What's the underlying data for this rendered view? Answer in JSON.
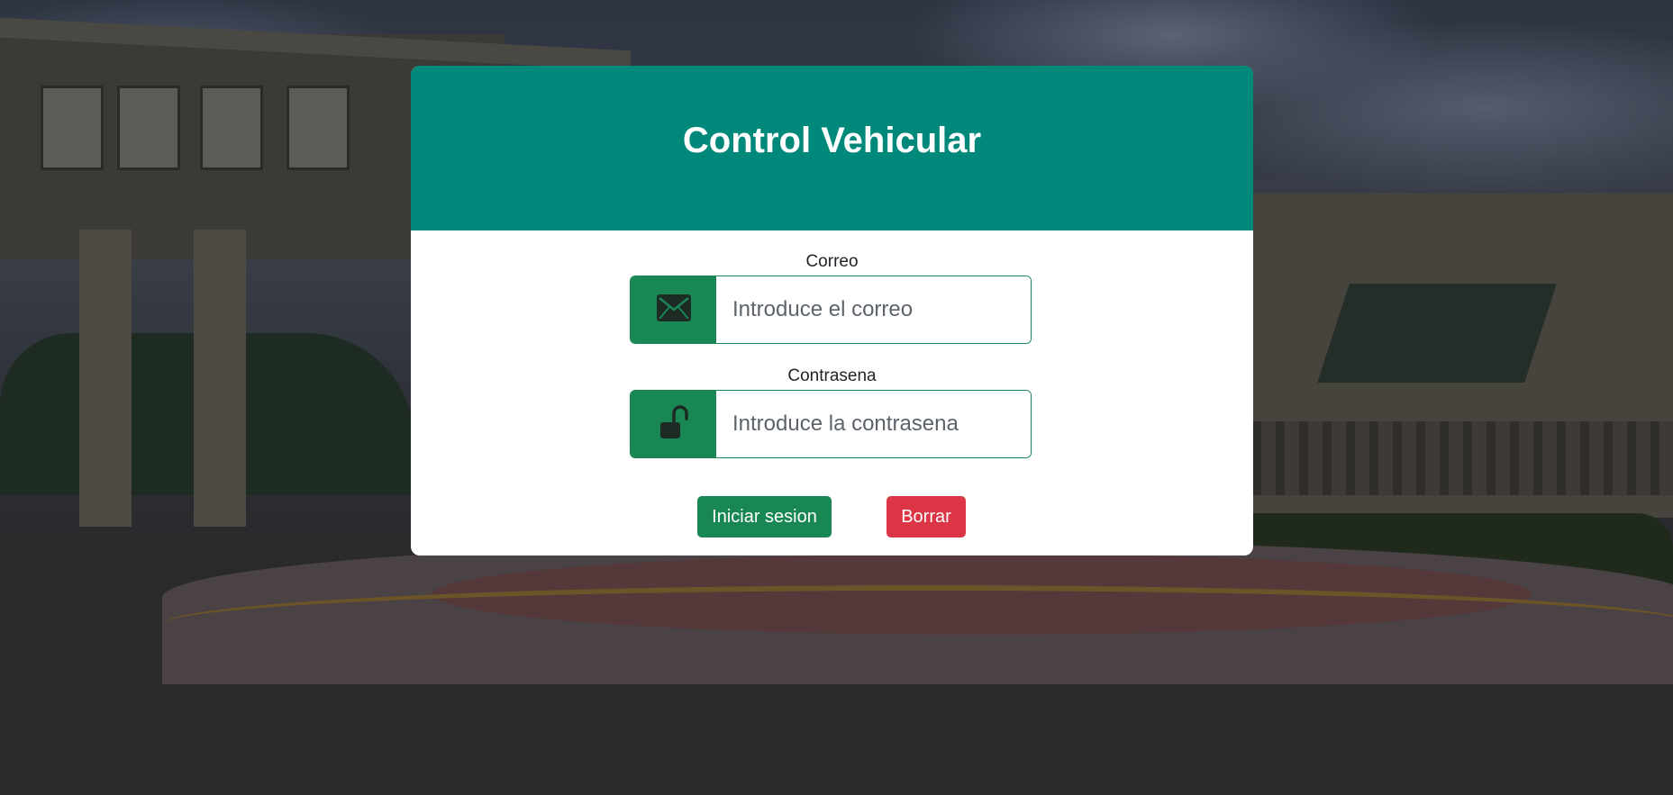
{
  "header": {
    "title": "Control Vehicular"
  },
  "form": {
    "email": {
      "label": "Correo",
      "placeholder": "Introduce el correo",
      "icon": "envelope-icon"
    },
    "password": {
      "label": "Contrasena",
      "placeholder": "Introduce la contrasena",
      "icon": "unlock-icon"
    },
    "buttons": {
      "login": "Iniciar sesion",
      "clear": "Borrar"
    }
  },
  "colors": {
    "header": "#00897b",
    "success": "#198754",
    "danger": "#dc3545",
    "icon": "#1e2a24"
  }
}
